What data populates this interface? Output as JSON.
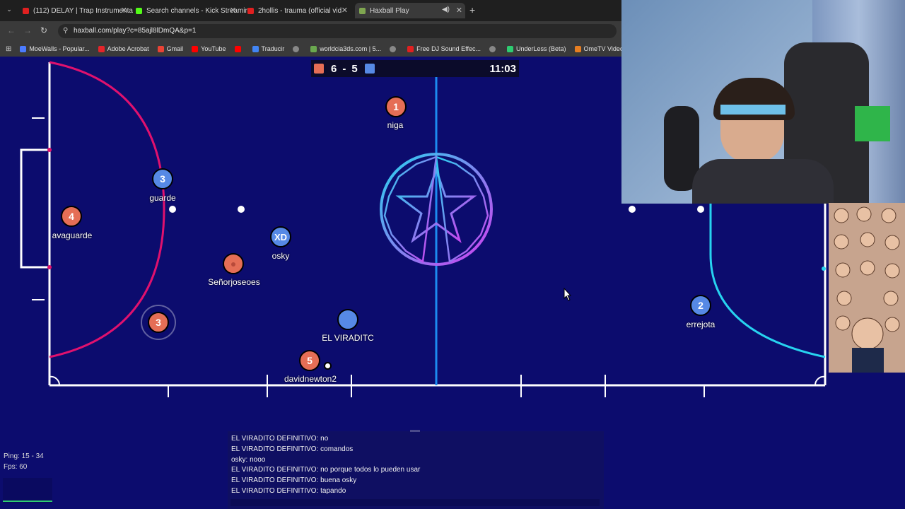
{
  "browser": {
    "tabs": [
      {
        "title": "(112) DELAY | Trap Instrumenta",
        "color": "#e02020",
        "close": "✕"
      },
      {
        "title": "Search channels - Kick Streamin",
        "color": "#53fc18",
        "close": "✕"
      },
      {
        "title": "2hollis - trauma (official vid",
        "color": "#e02020",
        "close": "✕"
      },
      {
        "title": "Haxball Play",
        "color": "#7fa650",
        "close": "✕"
      }
    ],
    "new_tab": "+",
    "url": "haxball.com/play?c=85ajl8lDmQA&p=1",
    "bookmarks": [
      {
        "label": "MoeWalls - Popular...",
        "color": "#4c7cff"
      },
      {
        "label": "Adobe Acrobat",
        "color": "#e5252a"
      },
      {
        "label": "Gmail",
        "color": "#ea4335"
      },
      {
        "label": "YouTube",
        "color": "#ff0000"
      },
      {
        "label": "",
        "color": "#ff0000"
      },
      {
        "label": "Traducir",
        "color": "#4285f4"
      },
      {
        "label": "",
        "color": "#888888"
      },
      {
        "label": "worldcia3ds.com | 5...",
        "color": "#6aa84f"
      },
      {
        "label": "",
        "color": "#888888"
      },
      {
        "label": "Free DJ Sound Effec...",
        "color": "#e02020"
      },
      {
        "label": "",
        "color": "#888888"
      },
      {
        "label": "UnderLess (Beta)",
        "color": "#2ecc71"
      },
      {
        "label": "OmeTV Video Chat...",
        "color": "#e67e22"
      }
    ]
  },
  "scoreboard": {
    "red_score": "6",
    "separator": "-",
    "blue_score": "5",
    "time": "11:03",
    "red_color": "#e56e56",
    "blue_color": "#5689e5"
  },
  "players": [
    {
      "num": "1",
      "name": "niga",
      "team": "red"
    },
    {
      "num": "3",
      "name": "guarde",
      "team": "blue"
    },
    {
      "num": "4",
      "name": "avaguarde",
      "team": "red"
    },
    {
      "num": "XD",
      "name": "osky",
      "team": "blue"
    },
    {
      "num": "",
      "name": "Señorjoseoes",
      "team": "red"
    },
    {
      "num": "3",
      "name": "",
      "team": "red"
    },
    {
      "num": "",
      "name": "EL VIRADITC",
      "team": "blue"
    },
    {
      "num": "5",
      "name": "davidnewton2",
      "team": "red"
    },
    {
      "num": "2",
      "name": "errejota",
      "team": "blue"
    }
  ],
  "chat": [
    "EL VIRADITO DEFINITIVO: no",
    "EL VIRADITO DEFINITIVO: comandos",
    "osky: nooo",
    "EL VIRADITO DEFINITIVO: no porque todos lo pueden usar",
    "EL VIRADITO DEFINITIVO: buena osky",
    "EL VIRADITO DEFINITIVO: tapando"
  ],
  "stats": {
    "ping": "Ping: 15 - 34",
    "fps": "Fps: 60"
  },
  "colors": {
    "field": "#0c0c6e",
    "red_team": "#e56e56",
    "blue_team": "#5689e5",
    "left_arc": "#e0116e",
    "right_arc": "#27d3f0"
  }
}
